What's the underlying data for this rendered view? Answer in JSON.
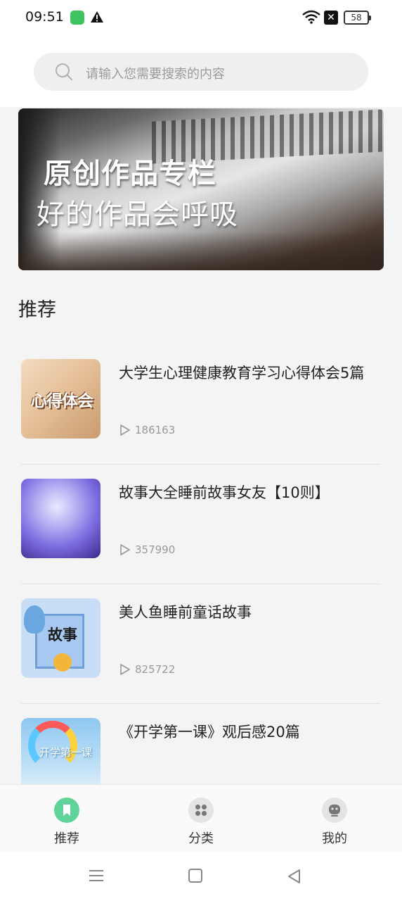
{
  "status_bar": {
    "time": "09:51",
    "battery": "58",
    "icons": [
      "wechat-icon",
      "alert-icon",
      "wifi-icon",
      "close-box-icon",
      "battery-icon"
    ]
  },
  "search": {
    "placeholder": "请输入您需要搜索的内容"
  },
  "banner": {
    "title": "原创作品专栏",
    "subtitle": "好的作品会呼吸"
  },
  "section": {
    "title": "推荐"
  },
  "articles": [
    {
      "title": "大学生心理健康教育学习心得体会5篇",
      "views": "186163",
      "thumb_text": "心得体会"
    },
    {
      "title": "故事大全睡前故事女友【10则】",
      "views": "357990",
      "thumb_text": ""
    },
    {
      "title": "美人鱼睡前童话故事",
      "views": "825722",
      "thumb_text": "故事"
    },
    {
      "title": "《开学第一课》观后感20篇",
      "views": "",
      "thumb_text": "开学第一课"
    }
  ],
  "tabs": [
    {
      "label": "推荐",
      "icon": "bookmark-icon",
      "active": true
    },
    {
      "label": "分类",
      "icon": "grid-icon",
      "active": false
    },
    {
      "label": "我的",
      "icon": "user-face-icon",
      "active": false
    }
  ],
  "colors": {
    "accent": "#5fd39a",
    "background": "#f4f4f4",
    "muted_text": "#999999"
  }
}
